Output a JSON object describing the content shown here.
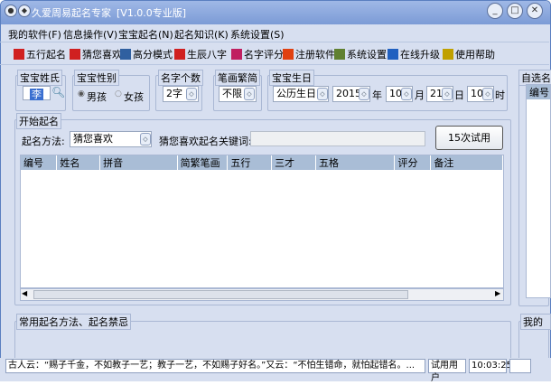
{
  "window": {
    "title": "久爱周易起名专家",
    "version": "[V1.0.0专业版]",
    "minimize": "_",
    "maximize": "□",
    "close": "✕"
  },
  "menu": [
    "我的软件(F)",
    "信息操作(V)",
    "宝宝起名(N)",
    "起名知识(K)",
    "系统设置(S)"
  ],
  "toolbar": [
    {
      "label": "五行起名",
      "icon": "wuxing-icon",
      "color": "#d02020"
    },
    {
      "label": "猜您喜欢",
      "icon": "star-icon",
      "color": "#d02020"
    },
    {
      "label": "高分模式",
      "icon": "monitor-icon",
      "color": "#3060a0"
    },
    {
      "label": "生辰八字",
      "icon": "calendar-icon",
      "color": "#d02020"
    },
    {
      "label": "名字评分",
      "icon": "badge-icon",
      "color": "#c02060"
    },
    {
      "label": "注册软件",
      "icon": "gift-icon",
      "color": "#e04010"
    },
    {
      "label": "系统设置",
      "icon": "settings-icon",
      "color": "#608030"
    },
    {
      "label": "在线升级",
      "icon": "globe-icon",
      "color": "#2060c0"
    },
    {
      "label": "使用帮助",
      "icon": "help-icon",
      "color": "#c0a000"
    }
  ],
  "form": {
    "surname_label": "宝宝姓氏",
    "surname": "李",
    "gender_label": "宝宝性别",
    "male": "男孩",
    "female": "女孩",
    "gender_selected": "male",
    "count_label": "名字个数",
    "count": "2字",
    "stroke_label": "笔画繁简",
    "stroke": "不限",
    "birthday_label": "宝宝生日",
    "calendar": "公历生日",
    "year": "2015",
    "year_unit": "年",
    "month": "10",
    "month_unit": "月",
    "day": "21",
    "day_unit": "日",
    "hour": "10",
    "hour_unit": "时"
  },
  "start": {
    "label": "开始起名",
    "method_label": "起名方法:",
    "method": "猜您喜欢",
    "keyword_label": "猜您喜欢起名关键词:",
    "keyword": "",
    "trial_button": "15次试用"
  },
  "table": {
    "columns": [
      "编号",
      "姓名",
      "拼音",
      "简繁笔画",
      "五行",
      "三才",
      "五格",
      "评分",
      "备注"
    ],
    "rows": []
  },
  "right": {
    "selected_label": "自选名",
    "col": "编号",
    "mine_label": "我的"
  },
  "tips": {
    "label": "常用起名方法、起名禁忌"
  },
  "status": {
    "quote": "古人云：“赐子千金，不如教子一艺；教子一艺，不如赐子好名。”又云：“不怕生错命，就怕起错名。...",
    "user": "试用用户",
    "time": "10:03:25"
  }
}
